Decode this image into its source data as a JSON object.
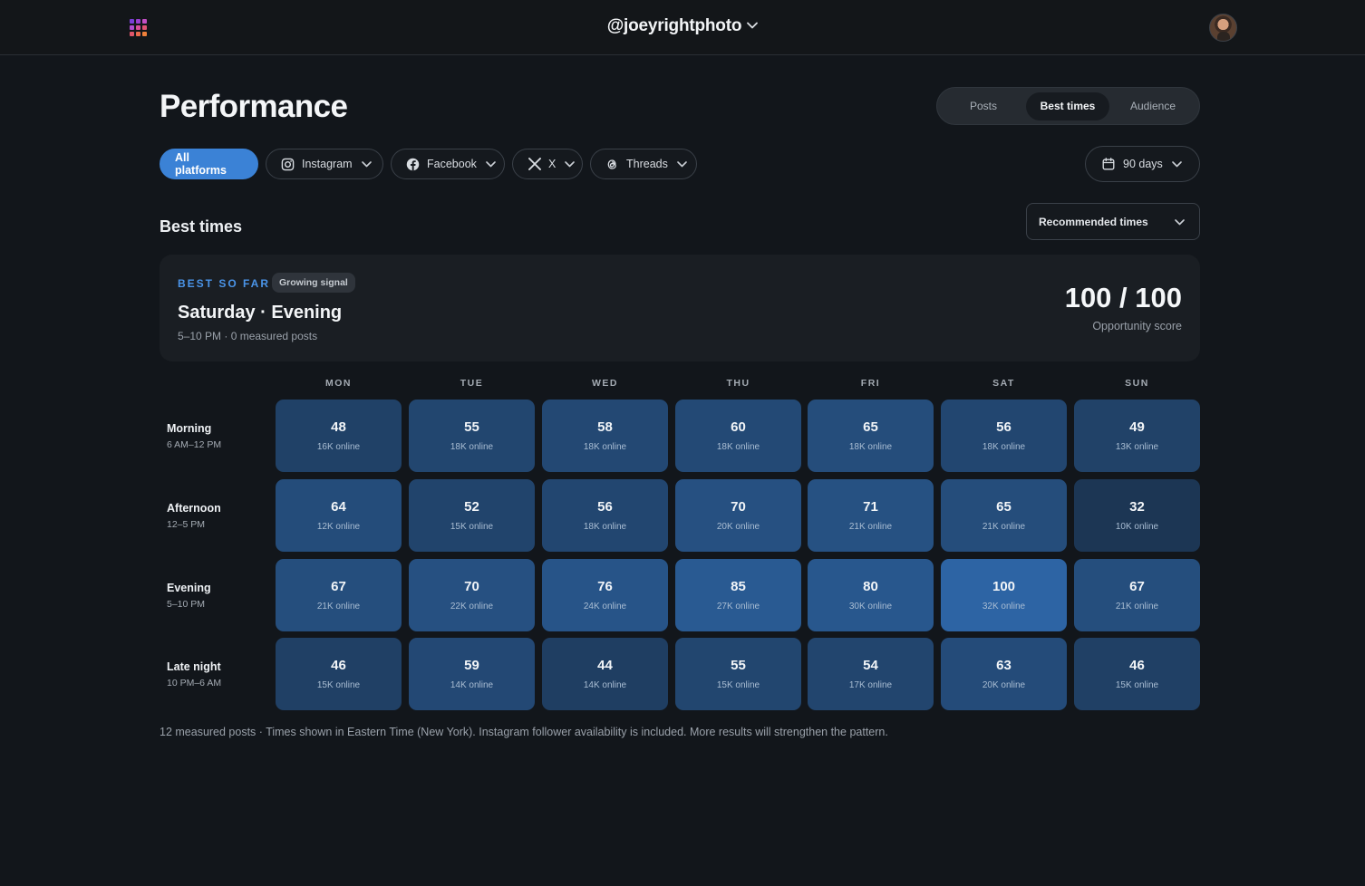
{
  "header": {
    "account": "@joeyrightphoto",
    "app_grid_colors": [
      "#7a3fd6",
      "#9a3fd0",
      "#c34fc4",
      "#b24bd0",
      "#d84f9a",
      "#e05274",
      "#e0566a",
      "#ea6a4c",
      "#f0803a"
    ]
  },
  "page": {
    "title": "Performance",
    "tabs": [
      {
        "label": "Posts",
        "active": false
      },
      {
        "label": "Best times",
        "active": true
      },
      {
        "label": "Audience",
        "active": false
      }
    ]
  },
  "filters": {
    "all_label": "All platforms",
    "platforms": [
      {
        "label": "Instagram",
        "icon": "instagram-icon"
      },
      {
        "label": "Facebook",
        "icon": "facebook-icon"
      },
      {
        "label": "X",
        "icon": "x-icon"
      },
      {
        "label": "Threads",
        "icon": "threads-icon"
      }
    ],
    "range_label": "90 days"
  },
  "best_times": {
    "title": "Best times",
    "mode_select": "Recommended times",
    "best": {
      "label": "BEST SO FAR",
      "badge": "Growing signal",
      "slot": "Saturday · Evening",
      "meta": "5–10 PM · 0 measured posts",
      "score": "100 / 100",
      "score_label": "Opportunity score"
    },
    "days": [
      "MON",
      "TUE",
      "WED",
      "THU",
      "FRI",
      "SAT",
      "SUN"
    ],
    "rows": [
      {
        "name": "Morning",
        "range": "6 AM–12 PM",
        "scores": [
          48,
          55,
          58,
          60,
          65,
          56,
          49
        ],
        "online": [
          "16K online",
          "18K online",
          "18K online",
          "18K online",
          "18K online",
          "18K online",
          "13K online"
        ]
      },
      {
        "name": "Afternoon",
        "range": "12–5 PM",
        "scores": [
          64,
          52,
          56,
          70,
          71,
          65,
          32
        ],
        "online": [
          "12K online",
          "15K online",
          "18K online",
          "20K online",
          "21K online",
          "21K online",
          "10K online"
        ]
      },
      {
        "name": "Evening",
        "range": "5–10 PM",
        "scores": [
          67,
          70,
          76,
          85,
          80,
          100,
          67
        ],
        "online": [
          "21K online",
          "22K online",
          "24K online",
          "27K online",
          "30K online",
          "32K online",
          "21K online"
        ]
      },
      {
        "name": "Late night",
        "range": "10 PM–6 AM",
        "scores": [
          46,
          59,
          44,
          55,
          54,
          63,
          46
        ],
        "online": [
          "15K online",
          "14K online",
          "14K online",
          "15K online",
          "17K online",
          "20K online",
          "15K online"
        ]
      }
    ],
    "footnote": "12 measured posts · Times shown in Eastern Time (New York). Instagram follower availability is included. More results will strengthen the pattern."
  },
  "colors": {
    "accent": "#3b82d6",
    "cell_low": "#1c3552",
    "cell_high": "#2d64a4"
  }
}
